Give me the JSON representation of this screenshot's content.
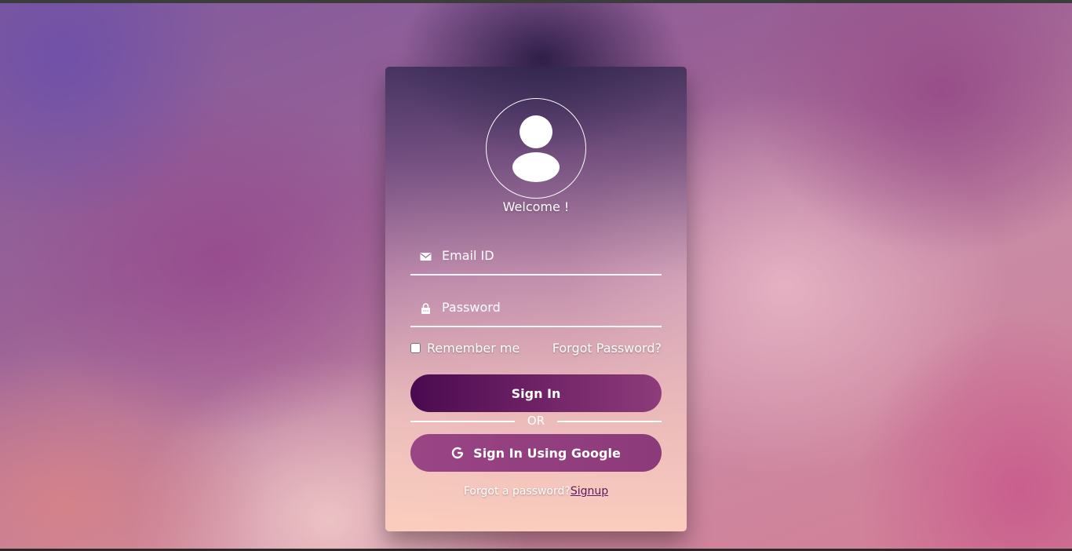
{
  "login": {
    "welcome": "Welcome !",
    "email_placeholder": "Email ID",
    "password_placeholder": "Password",
    "remember_label": "Remember me",
    "remember_checked": false,
    "forgot_password_link": "Forgot Password?",
    "signin_button": "Sign In",
    "divider_text": "OR",
    "google_button": "Sign In Using Google",
    "footer_text": "Forgot a password?",
    "footer_link": "Signup"
  },
  "icons": {
    "avatar": "user-avatar-icon",
    "email": "envelope-icon",
    "password": "lock-icon",
    "google": "google-icon"
  },
  "colors": {
    "signin_gradient_start": "#4a0a4f",
    "signin_gradient_end": "#8e3c7a",
    "google_button": "#9a4585",
    "footer_link": "#5a1458"
  }
}
